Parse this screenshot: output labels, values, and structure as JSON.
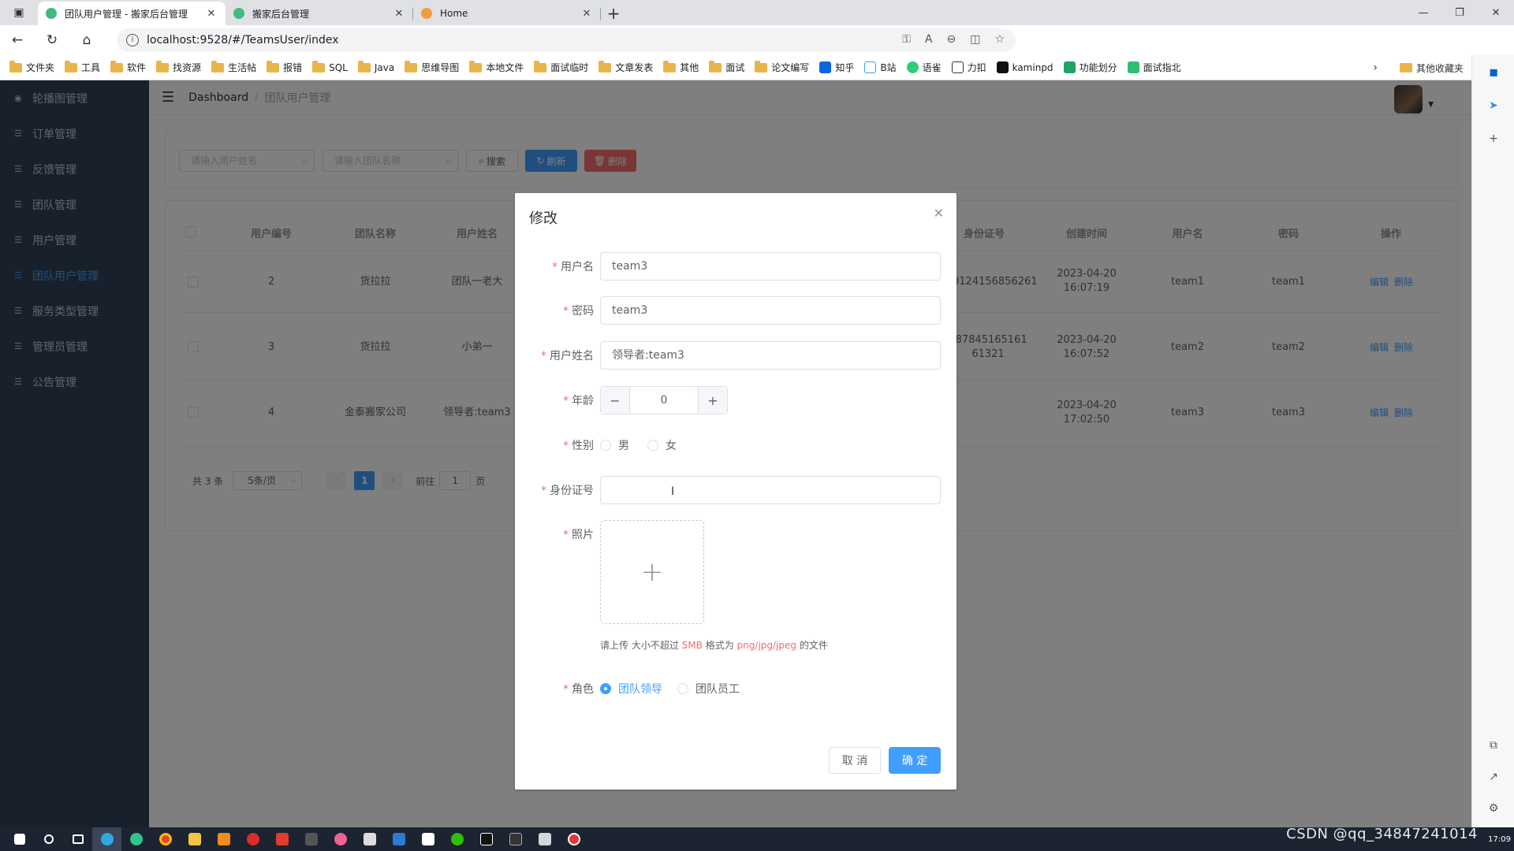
{
  "browser": {
    "tabs": [
      {
        "title": "团队用户管理 - 搬家后台管理",
        "active": true
      },
      {
        "title": "搬家后台管理",
        "active": false
      },
      {
        "title": "Home",
        "active": false
      }
    ],
    "url": "localhost:9528/#/TeamsUser/index",
    "bookmarks": [
      "文件夹",
      "工具",
      "软件",
      "找资源",
      "生活帖",
      "报错",
      "SQL",
      "Java",
      "思维导图",
      "本地文件",
      "面试临时",
      "文章发表",
      "其他",
      "面试",
      "论文编写",
      "知乎",
      "B站",
      "语雀",
      "力扣",
      "kaminpd",
      "功能划分",
      "面试指北"
    ],
    "bookmarks_other": "其他收藏夹"
  },
  "sidebar": {
    "items": [
      {
        "label": "轮播图管理",
        "active": false
      },
      {
        "label": "订单管理",
        "active": false
      },
      {
        "label": "反馈管理",
        "active": false
      },
      {
        "label": "团队管理",
        "active": false
      },
      {
        "label": "用户管理",
        "active": false
      },
      {
        "label": "团队用户管理",
        "active": true
      },
      {
        "label": "服务类型管理",
        "active": false
      },
      {
        "label": "管理员管理",
        "active": false
      },
      {
        "label": "公告管理",
        "active": false
      }
    ]
  },
  "breadcrumb": {
    "home": "Dashboard",
    "current": "团队用户管理"
  },
  "filter": {
    "name_placeholder": "请输入用户姓名",
    "team_placeholder": "请输入团队名称",
    "search_label": "搜索",
    "refresh_label": "刷新",
    "delete_label": "删除"
  },
  "table": {
    "headers": [
      "用户编号",
      "团队名称",
      "用户姓名",
      "身份证号",
      "创建时间",
      "用户名",
      "密码",
      "操作"
    ],
    "rows": [
      {
        "id": "2",
        "team": "货拉拉",
        "name": "团队一老大",
        "idcard": "0124156856261",
        "created": "2023-04-20 16:07:19",
        "username": "team1",
        "password": "team1"
      },
      {
        "id": "3",
        "team": "货拉拉",
        "name": "小弟一",
        "idcard": "68784516516161321",
        "created": "2023-04-20 16:07:52",
        "username": "team2",
        "password": "team2"
      },
      {
        "id": "4",
        "team": "金泰搬家公司",
        "name": "领导者:team3",
        "idcard": "",
        "created": "2023-04-20 17:02:50",
        "username": "team3",
        "password": "team3"
      }
    ],
    "edit_label": "编辑",
    "del_label": "删除"
  },
  "pager": {
    "total": "共 3 条",
    "page_size": "5条/页",
    "current": "1",
    "goto": "前往",
    "goto_value": "1",
    "page_unit": "页"
  },
  "dialog": {
    "title": "修改",
    "username_label": "用户名",
    "username_value": "team3",
    "password_label": "密码",
    "password_value": "team3",
    "realname_label": "用户姓名",
    "realname_value": "领导者:team3",
    "age_label": "年龄",
    "age_value": "0",
    "gender_label": "性别",
    "gender_male": "男",
    "gender_female": "女",
    "idcard_label": "身份证号",
    "idcard_value": "",
    "photo_label": "照片",
    "upload_tip_prefix": "请上传 大小不超过",
    "upload_tip_size": "5MB",
    "upload_tip_mid": "格式为",
    "upload_tip_formats": "png/jpg/jpeg",
    "upload_tip_suffix": "的文件",
    "role_label": "角色",
    "role_leader": "团队领导",
    "role_staff": "团队员工",
    "cancel_label": "取 消",
    "confirm_label": "确 定"
  },
  "watermark": "CSDN @qq_34847241014",
  "clock": "17:09",
  "colors": {
    "primary": "#409eff",
    "danger": "#f56c6c",
    "sidebar": "#304156"
  }
}
